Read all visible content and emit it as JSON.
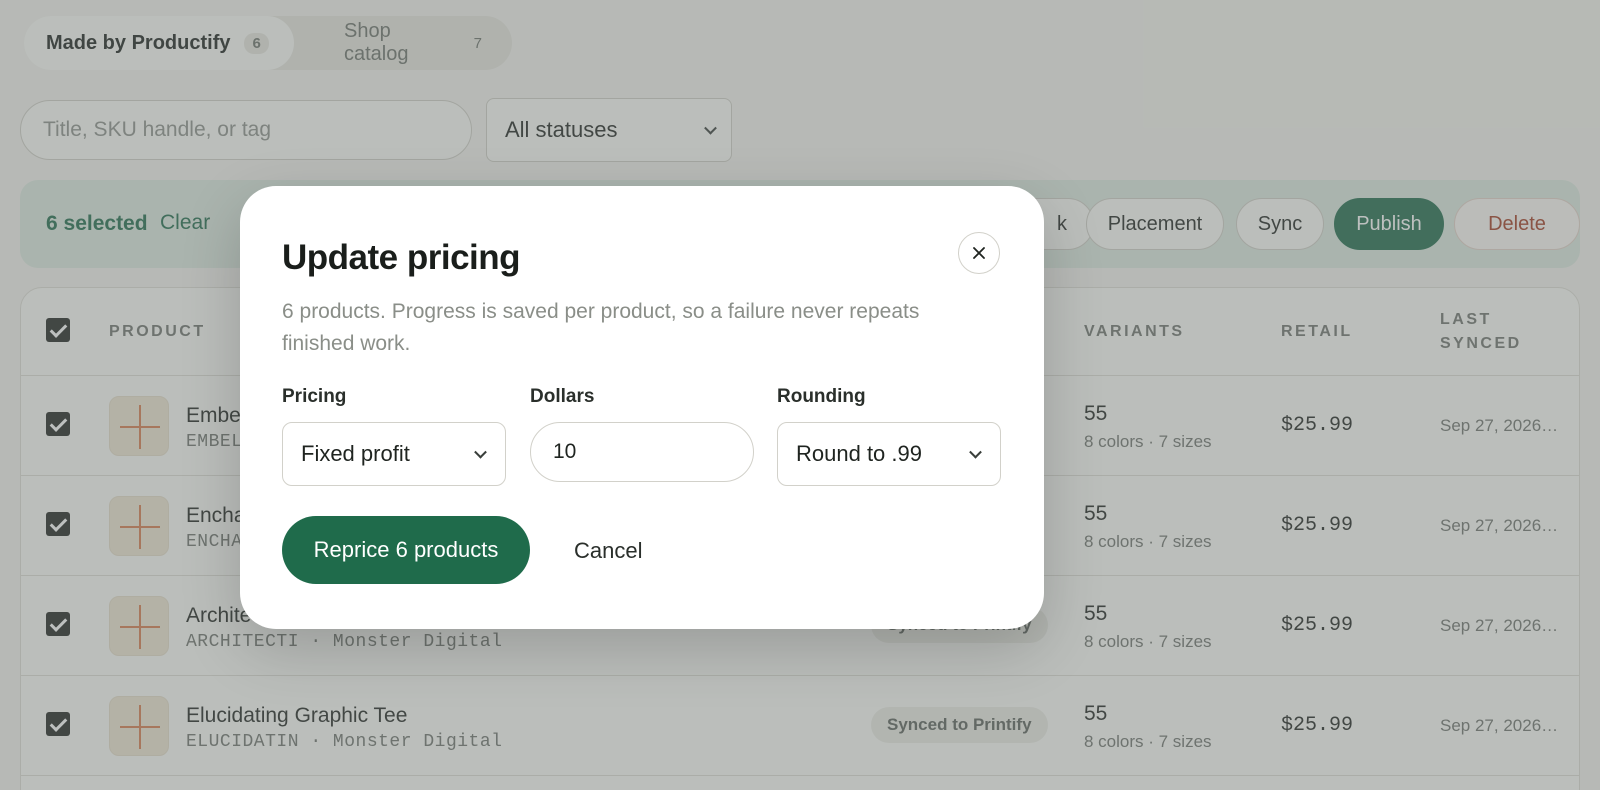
{
  "tabs": [
    {
      "label": "Made by Productify",
      "count": "6",
      "active": true
    },
    {
      "label": "Shop catalog",
      "count": "7",
      "active": false
    }
  ],
  "filters": {
    "search_placeholder": "Title, SKU handle, or tag",
    "status_value": "All statuses"
  },
  "bulk_bar": {
    "selected_label": "6 selected",
    "clear_label": "Clear",
    "actions": {
      "partial_label": "k",
      "placement": "Placement",
      "sync": "Sync",
      "publish": "Publish",
      "delete": "Delete"
    }
  },
  "table": {
    "headers": {
      "product": "PRODUCT",
      "variants": "VARIANTS",
      "retail": "RETAIL",
      "last_synced": "LAST SYNCED"
    },
    "rows": [
      {
        "name": "Embel",
        "sku": "EMBELL",
        "status": "",
        "variants": "55",
        "variant_detail": "8 colors · 7 sizes",
        "retail": "$25.99",
        "synced": "Sep 27, 2026…"
      },
      {
        "name": "Encha",
        "sku": "ENCHAN",
        "status": "",
        "variants": "55",
        "variant_detail": "8 colors · 7 sizes",
        "retail": "$25.99",
        "synced": "Sep 27, 2026…"
      },
      {
        "name": "Archite",
        "sku": "ARCHITECTI · Monster Digital",
        "status": "Synced to Printify",
        "variants": "55",
        "variant_detail": "8 colors · 7 sizes",
        "retail": "$25.99",
        "synced": "Sep 27, 2026…"
      },
      {
        "name": "Elucidating Graphic Tee",
        "sku": "ELUCIDATIN · Monster Digital",
        "status": "Synced to Printify",
        "variants": "55",
        "variant_detail": "8 colors · 7 sizes",
        "retail": "$25.99",
        "synced": "Sep 27, 2026…"
      }
    ]
  },
  "modal": {
    "title": "Update pricing",
    "description": "6 products. Progress is saved per product, so a failure never repeats finished work.",
    "pricing_label": "Pricing",
    "pricing_value": "Fixed profit",
    "dollars_label": "Dollars",
    "dollars_value": "10",
    "rounding_label": "Rounding",
    "rounding_value": "Round to .99",
    "primary_label": "Reprice 6 products",
    "cancel_label": "Cancel"
  },
  "colors": {
    "accent": "#1f6b4b",
    "danger": "#a23b22",
    "overlay": "#6c7470"
  },
  "icons": {
    "close": "close-icon",
    "chevron": "chevron-down-icon",
    "checkbox": "checkbox-checked-icon",
    "thumbnail": "product-thumbnail-icon"
  }
}
